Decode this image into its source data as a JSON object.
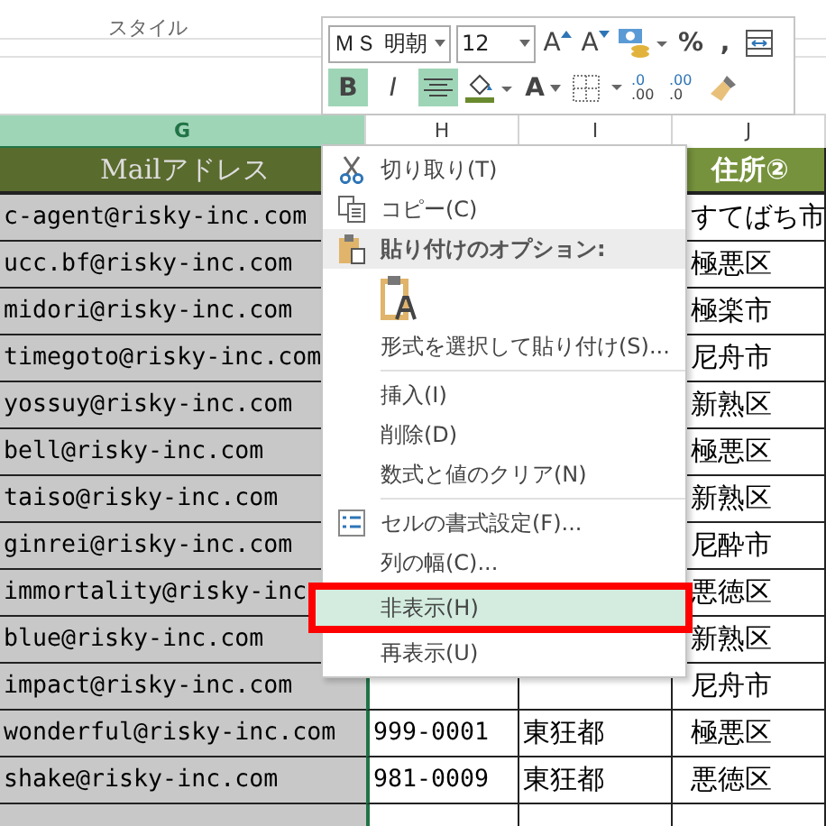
{
  "ribbon": {
    "group_label": "スタイル"
  },
  "mini_toolbar": {
    "font": "ＭＳ 明朝",
    "size": "12",
    "row1": [
      {
        "kind": "grow",
        "text": "A"
      },
      {
        "kind": "shrink",
        "text": "A"
      },
      {
        "kind": "accounting"
      },
      {
        "kind": "glyph",
        "text": "%"
      },
      {
        "kind": "glyph",
        "text": ","
      },
      {
        "kind": "format"
      }
    ],
    "row2": [
      {
        "kind": "bold",
        "text": "B",
        "selected": true
      },
      {
        "kind": "italic",
        "text": "I",
        "selected": false
      },
      {
        "kind": "center",
        "selected": true
      },
      {
        "kind": "fill"
      },
      {
        "kind": "fontcolor",
        "text": "A"
      },
      {
        "kind": "borders"
      },
      {
        "kind": "decinc",
        "top": ".0",
        "bottom": ".00"
      },
      {
        "kind": "decdec",
        "top": ".00",
        "bottom": ".0"
      },
      {
        "kind": "painter"
      }
    ]
  },
  "columns": [
    {
      "label": "G",
      "selected": true
    },
    {
      "label": "H",
      "selected": false
    },
    {
      "label": "I",
      "selected": false
    },
    {
      "label": "J",
      "selected": false
    }
  ],
  "table": {
    "header_g": "Mailアドレス",
    "header_j": "住所②",
    "rows": [
      {
        "email": "c-agent@risky-inc.com",
        "j": "すてばち市"
      },
      {
        "email": "ucc.bf@risky-inc.com",
        "j": "極悪区"
      },
      {
        "email": "midori@risky-inc.com",
        "j": "極楽市"
      },
      {
        "email": "timegoto@risky-inc.com",
        "j": "尼舟市"
      },
      {
        "email": "yossuy@risky-inc.com",
        "j": "新熟区"
      },
      {
        "email": "bell@risky-inc.com",
        "j": "極悪区"
      },
      {
        "email": "taiso@risky-inc.com",
        "j": "新熟区"
      },
      {
        "email": "ginrei@risky-inc.com",
        "j": "尼酔市"
      },
      {
        "email": "immortality@risky-inc",
        "j": "悪徳区"
      },
      {
        "email": "blue@risky-inc.com",
        "j": "新熟区"
      },
      {
        "email": "impact@risky-inc.com",
        "j": "尼舟市"
      },
      {
        "email": "wonderful@risky-inc.com",
        "h": "999-0001",
        "i": "東狂都",
        "j": "極悪区"
      },
      {
        "email": "shake@risky-inc.com",
        "h": "981-0009",
        "i": "東狂都",
        "j": "悪徳区"
      }
    ]
  },
  "context_menu": [
    {
      "kind": "cut",
      "label": "切り取り(T)"
    },
    {
      "kind": "copy",
      "label": "コピー(C)"
    },
    {
      "kind": "header",
      "label": "貼り付けのオプション:"
    },
    {
      "kind": "paste"
    },
    {
      "kind": "item",
      "label": "形式を選択して貼り付け(S)..."
    },
    {
      "kind": "separator"
    },
    {
      "kind": "item",
      "label": "挿入(I)"
    },
    {
      "kind": "item",
      "label": "削除(D)"
    },
    {
      "kind": "item",
      "label": "数式と値のクリア(N)"
    },
    {
      "kind": "separator"
    },
    {
      "kind": "format",
      "label": "セルの書式設定(F)..."
    },
    {
      "kind": "item",
      "label": "列の幅(C)..."
    },
    {
      "kind": "item",
      "label": "非表示(H)",
      "selected": true,
      "annotated": true
    },
    {
      "kind": "item",
      "label": "再表示(U)",
      "selected": false
    }
  ]
}
